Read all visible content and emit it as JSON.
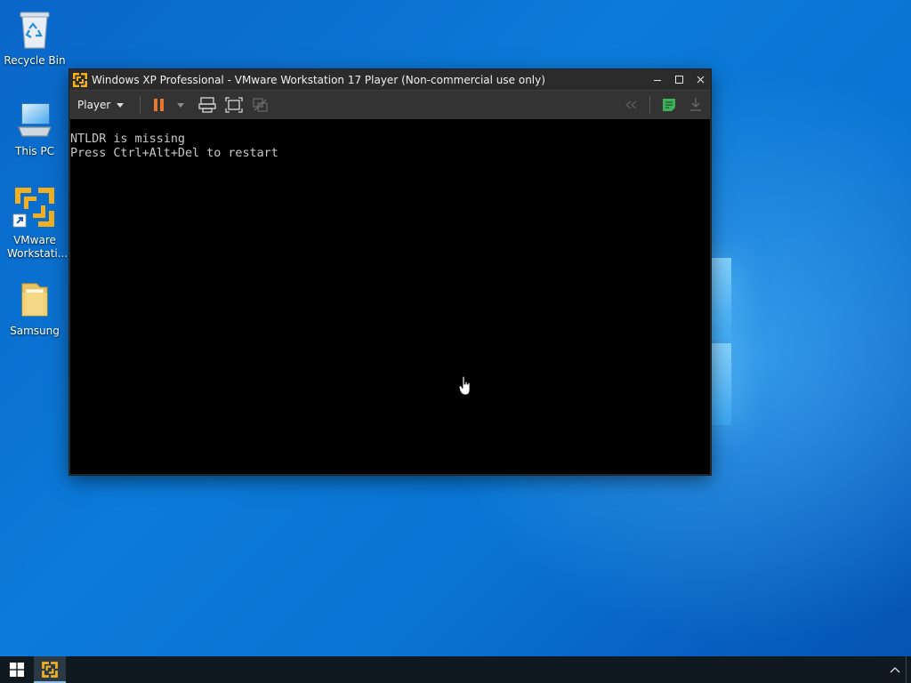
{
  "desktop": {
    "icons": [
      {
        "label": "Recycle Bin",
        "icon": "recycle-bin-icon"
      },
      {
        "label": "This PC",
        "icon": "computer-icon"
      },
      {
        "label": "VMware Workstati...",
        "icon": "vmware-shortcut-icon"
      },
      {
        "label": "Samsung",
        "icon": "folder-icon"
      }
    ]
  },
  "window": {
    "title": "Windows XP Professional - VMware Workstation 17 Player (Non-commercial use only)",
    "controls": {
      "minimize": "—",
      "maximize": "☐",
      "close": "✕"
    },
    "toolbar": {
      "player_menu": "Player",
      "buttons": [
        "pause-icon",
        "dropdown-arrow-icon",
        "send-ctrl-alt-del-icon",
        "fit-guest-icon",
        "unity-icon",
        "back-icon",
        "notes-icon",
        "download-icon"
      ]
    },
    "console": {
      "lines": [
        "NTLDR is missing",
        "Press Ctrl+Alt+Del to restart"
      ]
    }
  },
  "taskbar": {
    "start": "windows-logo-icon",
    "pinned": [
      "vmware-player-icon"
    ],
    "tray": [
      "chevron-up-icon"
    ]
  },
  "colors": {
    "accent_orange": "#e8762c",
    "vmware_yellow": "#f2b01e",
    "desktop_blue": "#0b7ad8",
    "taskbar": "#101820"
  }
}
